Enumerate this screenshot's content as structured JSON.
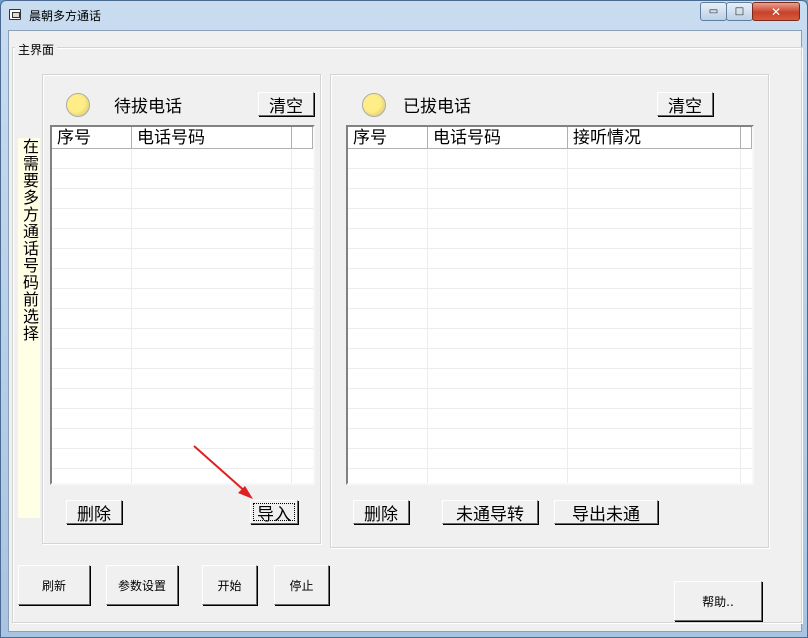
{
  "window": {
    "title": "晨朝多方通话",
    "min_glyph": "▭",
    "max_glyph": "□",
    "close_glyph": "✕"
  },
  "main_frame": {
    "caption": "主界面"
  },
  "side_label": "在需要多方通话号码前选择",
  "left_panel": {
    "title": "待拔电话",
    "clear_label": "清空",
    "columns": [
      "序号",
      "电话号码",
      ""
    ],
    "delete_label": "删除",
    "import_label": "导入"
  },
  "right_panel": {
    "title": "已拔电话",
    "clear_label": "清空",
    "columns": [
      "序号",
      "电话号码",
      "接听情况",
      ""
    ],
    "delete_label": "删除",
    "transfer_label": "未通导转",
    "export_label": "导出未通"
  },
  "bottom_buttons": {
    "refresh": "刷新",
    "settings": "参数设置",
    "start": "开始",
    "stop": "停止",
    "help": "帮助.."
  },
  "colors": {
    "accent_arrow": "#e02020",
    "led": "#ffee88",
    "side_label_bg": "#ffffe6"
  }
}
